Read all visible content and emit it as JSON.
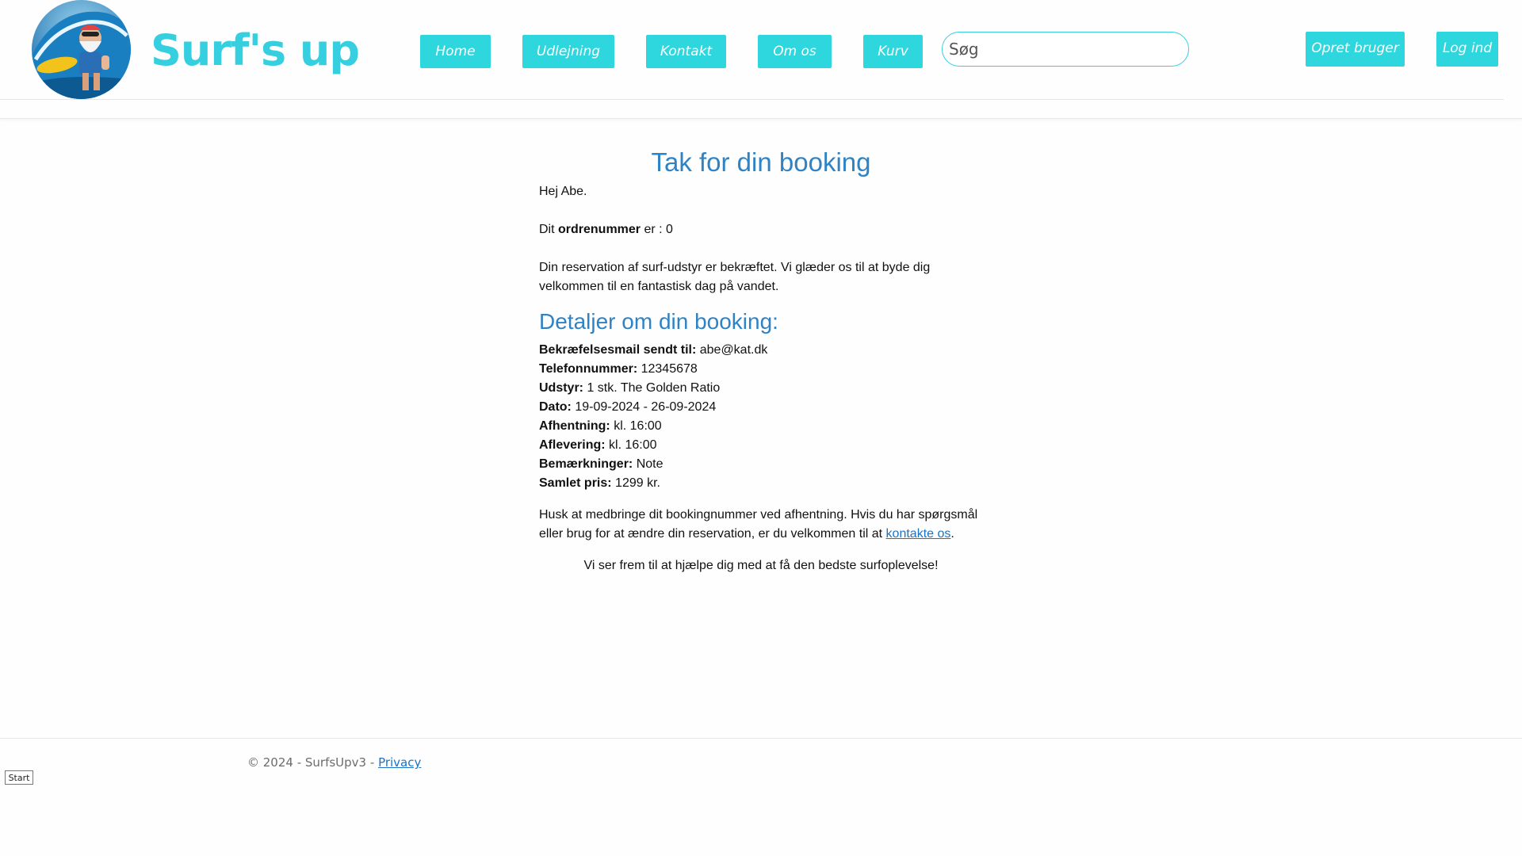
{
  "header": {
    "brand": "Surf's up",
    "nav": [
      "Home",
      "Udlejning",
      "Kontakt",
      "Om os",
      "Kurv"
    ],
    "search_placeholder": "Søg",
    "signup_label": "Opret bruger",
    "login_label": "Log ind"
  },
  "main": {
    "title": "Tak for din booking",
    "greeting": "Hej Abe.",
    "order_prefix": "Dit ",
    "order_label": "ordrenummer",
    "order_suffix": " er : 0",
    "confirmation_text": "Din reservation af surf-udstyr er bekræftet. Vi glæder os til at byde dig velkommen til en fantastisk dag på vandet.",
    "details_heading": "Detaljer om din booking:",
    "details": [
      {
        "label": "Bekræfelsesmail sendt til:",
        "value": " abe@kat.dk"
      },
      {
        "label": "Telefonnummer:",
        "value": " 12345678"
      },
      {
        "label": "Udstyr:",
        "value": " 1 stk. The Golden Ratio"
      },
      {
        "label": "Dato:",
        "value": " 19-09-2024 - 26-09-2024"
      },
      {
        "label": "Afhentning:",
        "value": " kl. 16:00"
      },
      {
        "label": "Aflevering:",
        "value": " kl. 16:00"
      },
      {
        "label": "Bemærkninger:",
        "value": " Note"
      },
      {
        "label": "Samlet pris:",
        "value": " 1299 kr."
      }
    ],
    "reminder_text": "Husk at medbringe dit bookingnummer ved afhentning. Hvis du har spørgsmål eller brug for at ændre din reservation, er du velkommen til at ",
    "contact_link": "kontakte os",
    "reminder_end": ".",
    "closing": "Vi ser frem til at hjælpe dig med at få den bedste surfoplevelse!"
  },
  "footer": {
    "copyright": "© 2024 - SurfsUpv3 - ",
    "privacy_link": "Privacy"
  },
  "start_button": "Start",
  "colors": {
    "accent": "#2ed6dd",
    "brand_text": "#35cfdf",
    "heading": "#2f83c5",
    "link": "#1a73c8"
  }
}
